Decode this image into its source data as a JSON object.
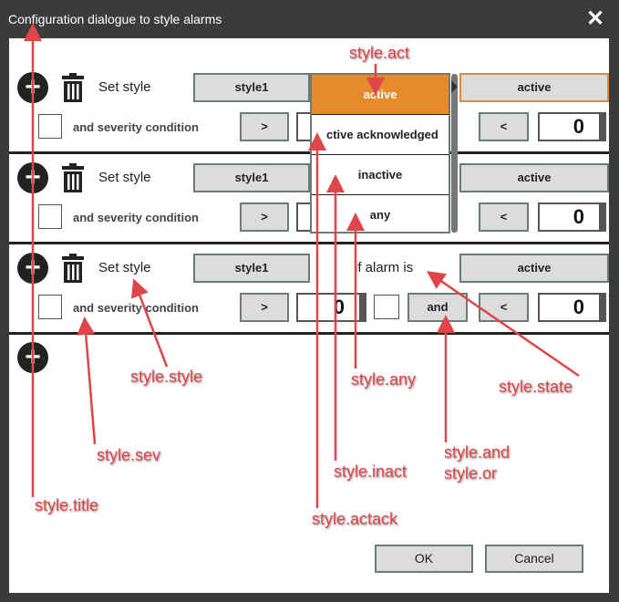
{
  "dialog": {
    "title": "Configuration dialogue to style alarms",
    "close": "✕"
  },
  "rows": [
    {
      "set_style": "Set style",
      "style_btn": "style1",
      "state_btn": "active",
      "sev_label": "and severity condition",
      "op1": ">",
      "op2": "<",
      "value2": "0"
    },
    {
      "set_style": "Set style",
      "style_btn": "style1",
      "state_btn": "active",
      "sev_label": "and severity condition",
      "op1": ">",
      "op2": "<",
      "value2": "0"
    },
    {
      "set_style": "Set style",
      "style_btn": "style1",
      "if_label": "if alarm is",
      "state_btn": "active",
      "sev_label": "and severity condition",
      "op1": ">",
      "value1": "0",
      "andor": "and",
      "op2": "<",
      "value2": "0"
    }
  ],
  "dropdown": {
    "options": [
      "active",
      "ctive acknowledged",
      "inactive",
      "any"
    ],
    "selected": "active",
    "accent": "#e68a2e"
  },
  "footer": {
    "ok": "OK",
    "cancel": "Cancel"
  },
  "annotations": {
    "act": "style.act",
    "style": "style.style",
    "any": "style.any",
    "state": "style.state",
    "sev": "style.sev",
    "and": "style.and",
    "or": "style.or",
    "inact": "style.inact",
    "title": "style.title",
    "actack": "style.actack"
  }
}
